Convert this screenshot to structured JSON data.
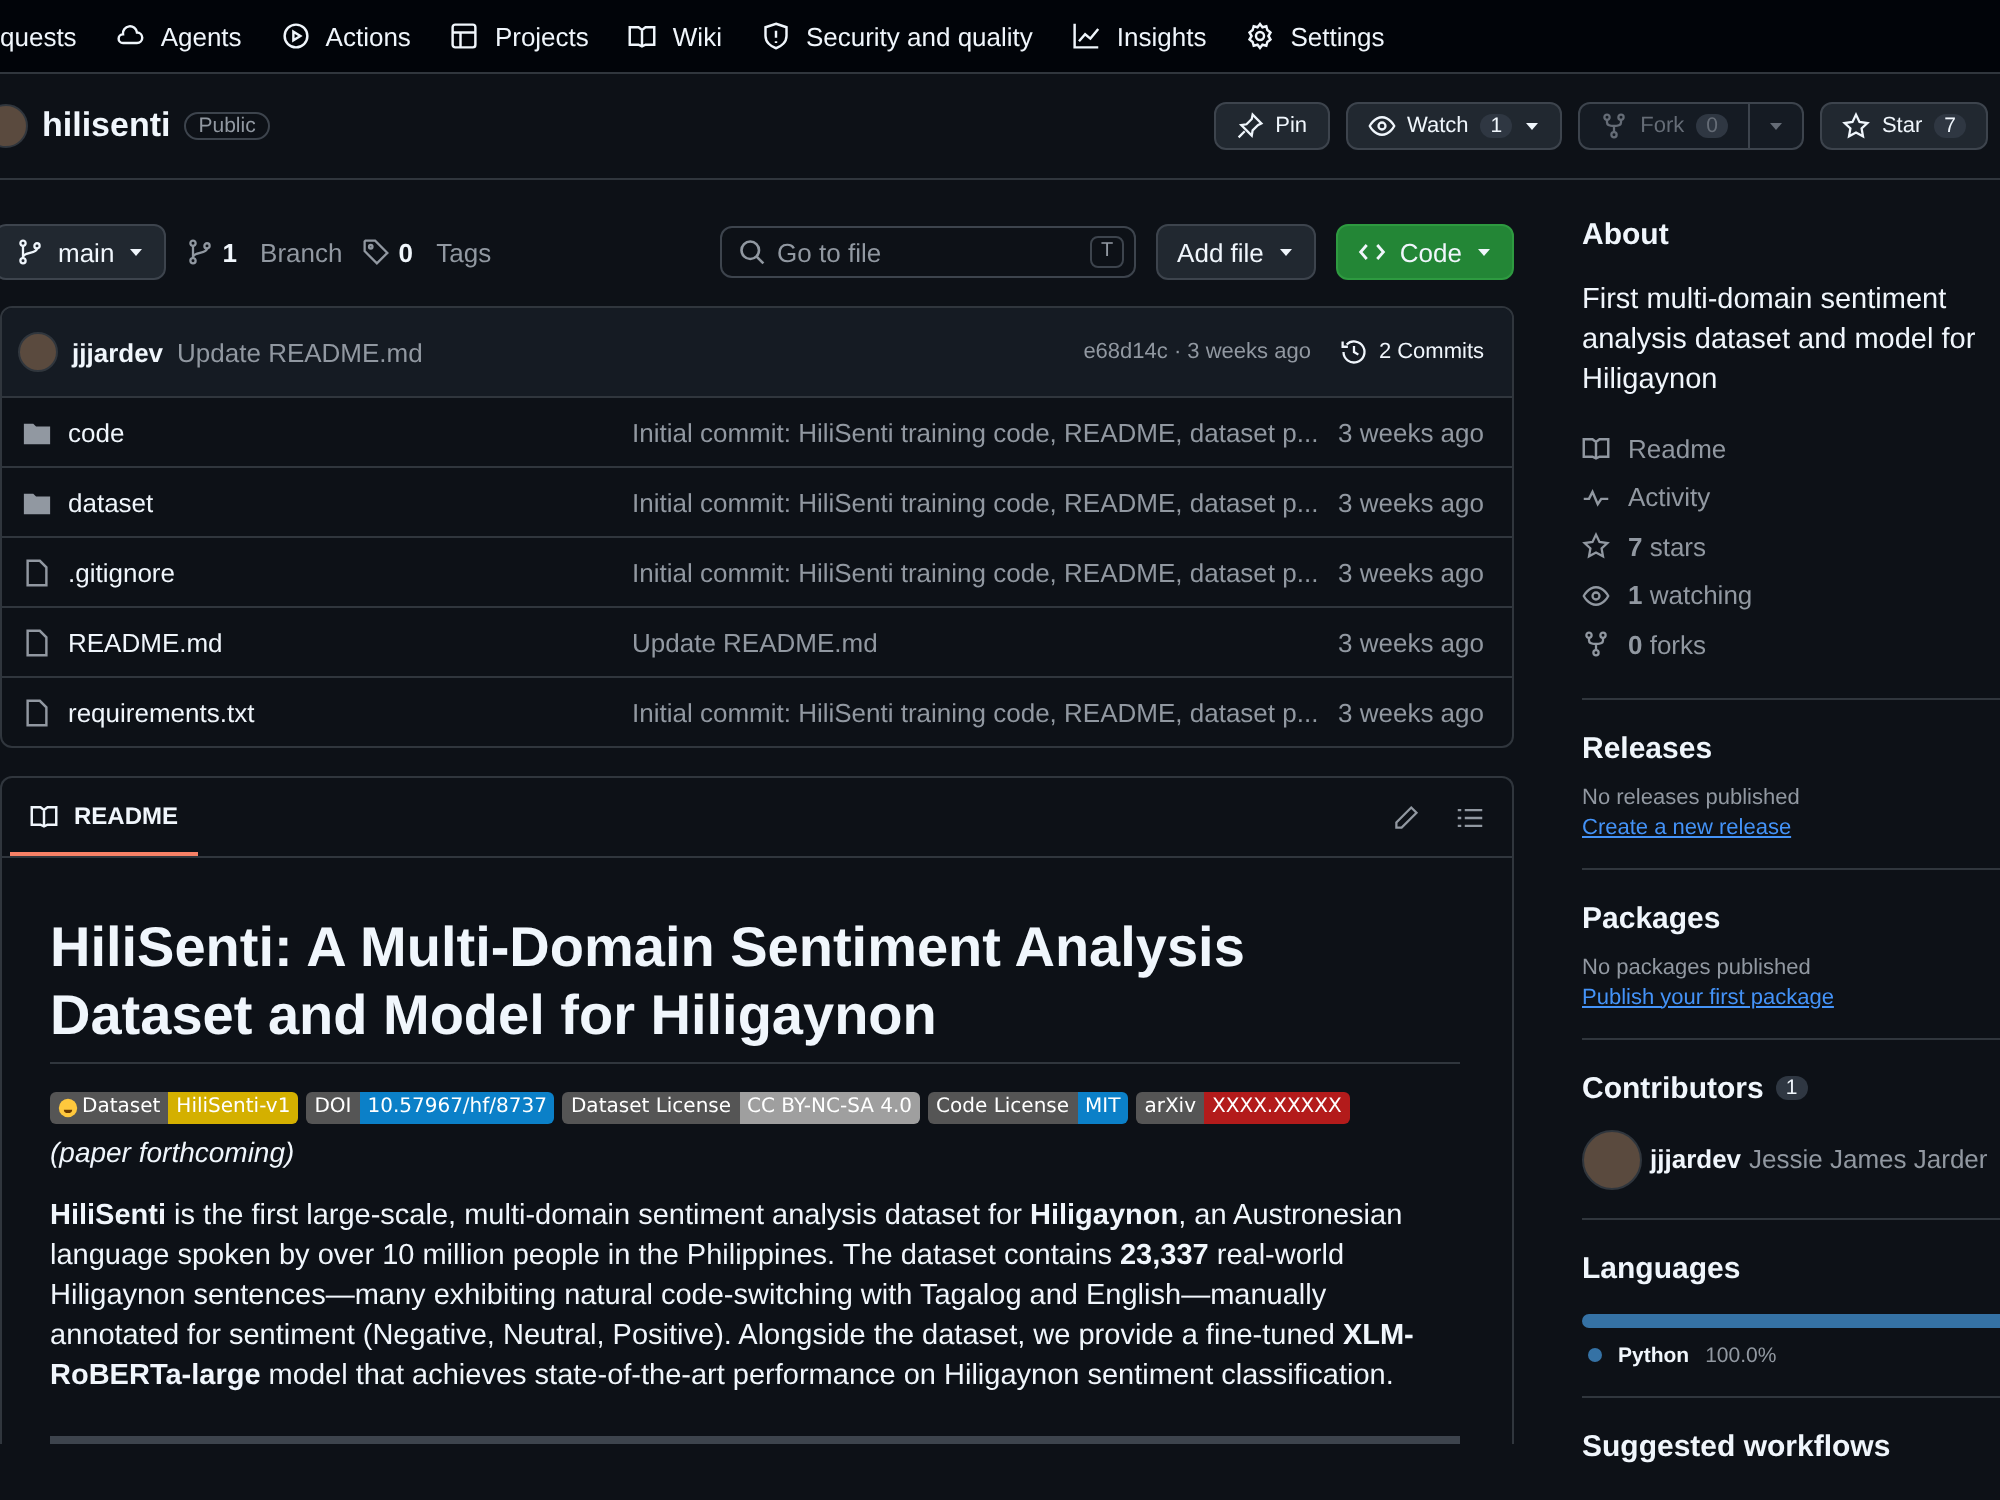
{
  "nav": [
    {
      "label": "quests"
    },
    {
      "label": "Agents"
    },
    {
      "label": "Actions"
    },
    {
      "label": "Projects"
    },
    {
      "label": "Wiki"
    },
    {
      "label": "Security and quality"
    },
    {
      "label": "Insights"
    },
    {
      "label": "Settings"
    }
  ],
  "repo": {
    "name": "hilisenti",
    "visibility": "Public"
  },
  "repo_buttons": [
    {
      "label": "Pin",
      "disabled": false
    },
    {
      "label": "Watch",
      "count": "1",
      "disabled": false
    },
    {
      "label": "Fork",
      "count": "0",
      "disabled": true
    },
    {
      "label": "Star",
      "count": "7",
      "disabled": false
    }
  ],
  "branch": {
    "name": "main",
    "branches_count": "1",
    "branches_label": "Branch",
    "tags_count": "0",
    "tags_label": "Tags"
  },
  "search": {
    "placeholder": "Go to file",
    "shortcut": "T"
  },
  "add_file": "Add file",
  "code_button": "Code",
  "latest_commit": {
    "author": "jjjardev",
    "message": "Update README.md",
    "sha_time": "e68d14c · 3 weeks ago",
    "commits": "2 Commits"
  },
  "files": [
    {
      "kind": "folder",
      "name": "code",
      "message": "Initial commit: HiliSenti training code, README, dataset p...",
      "time": "3 weeks ago"
    },
    {
      "kind": "folder",
      "name": "dataset",
      "message": "Initial commit: HiliSenti training code, README, dataset p...",
      "time": "3 weeks ago"
    },
    {
      "kind": "file",
      "name": ".gitignore",
      "message": "Initial commit: HiliSenti training code, README, dataset p...",
      "time": "3 weeks ago"
    },
    {
      "kind": "file",
      "name": "README.md",
      "message": "Update README.md",
      "time": "3 weeks ago"
    },
    {
      "kind": "file",
      "name": "requirements.txt",
      "message": "Initial commit: HiliSenti training code, README, dataset p...",
      "time": "3 weeks ago"
    }
  ],
  "readme": {
    "tab": "README",
    "title": "HiliSenti: A Multi-Domain Sentiment Analysis Dataset and Model for Hiligaynon",
    "badges": [
      {
        "label": "Dataset",
        "value": "HiliSenti-v1",
        "color": "#d4b000",
        "has_icon": true
      },
      {
        "label": "DOI",
        "value": "10.57967/hf/8737",
        "color": "#0b80c8",
        "has_icon": false
      },
      {
        "label": "Dataset License",
        "value": "CC BY-NC-SA 4.0",
        "color": "#9f9f9f",
        "has_icon": false
      },
      {
        "label": "Code License",
        "value": "MIT",
        "color": "#0b80c8",
        "has_icon": false
      },
      {
        "label": "arXiv",
        "value": "XXXX.XXXXX",
        "color": "#b31b1b",
        "has_icon": false
      }
    ],
    "badge_note": "(paper forthcoming)",
    "para": "**HiliSenti** is the first large-scale, multi-domain sentiment analysis dataset for **Hiligaynon**, an Austronesian language spoken by over 10 million people in the Philippines. The dataset contains **23,337** real-world Hiligaynon sentences—many exhibiting natural code-switching with Tagalog and English—manually annotated for sentiment (Negative, Neutral, Positive). Alongside the dataset, we provide a fine-tuned **XLM-RoBERTa-large** model that achieves state-of-the-art performance on Hiligaynon sentiment classification."
  },
  "about": {
    "title": "About",
    "description": "First multi-domain sentiment analysis dataset and model for Hiligaynon",
    "links": [
      {
        "kind": "readme",
        "label": "Readme"
      },
      {
        "kind": "activity",
        "label": "Activity"
      },
      {
        "kind": "stars",
        "count": "7",
        "label": "stars"
      },
      {
        "kind": "watching",
        "count": "1",
        "label": "watching"
      },
      {
        "kind": "forks",
        "count": "0",
        "label": "forks"
      }
    ]
  },
  "releases": {
    "title": "Releases",
    "note": "No releases published",
    "link": "Create a new release"
  },
  "packages": {
    "title": "Packages",
    "note": "No packages published",
    "link": "Publish your first package"
  },
  "contributors": {
    "title": "Contributors",
    "count": "1",
    "people": [
      {
        "login": "jjjardev",
        "name": "Jessie James Jarder"
      }
    ]
  },
  "languages": {
    "title": "Languages",
    "items": [
      {
        "name": "Python",
        "percent": "100.0%",
        "level": 1.0,
        "color": "#3572a5"
      }
    ]
  },
  "suggested": {
    "title": "Suggested workflows"
  }
}
